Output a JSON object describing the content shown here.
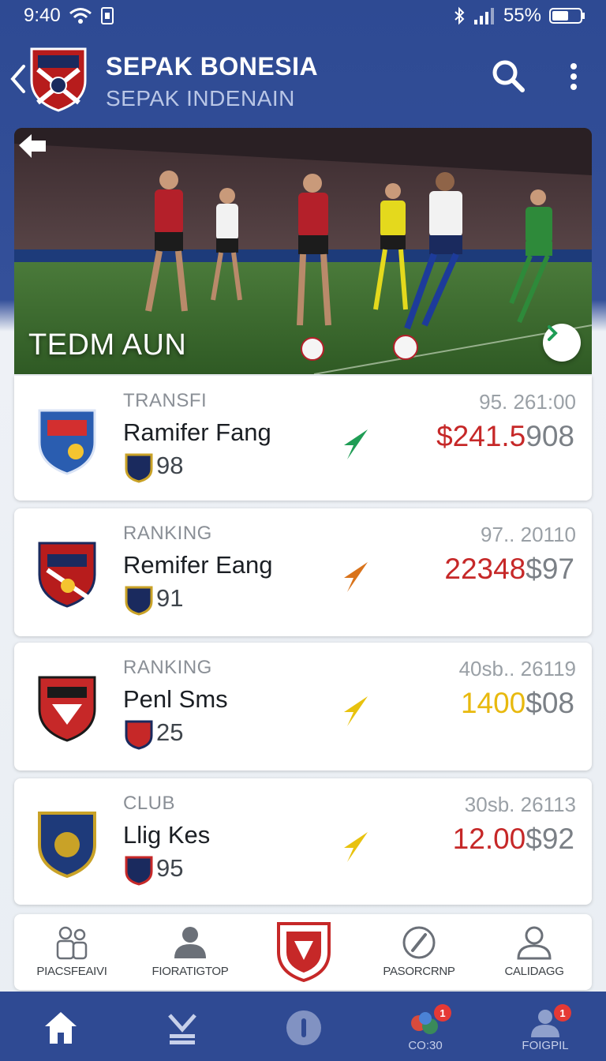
{
  "status_bar": {
    "time": "9:40",
    "battery": "55%"
  },
  "header": {
    "title": "SEPAK BONESIA",
    "subtitle": "SEPAK INDENAIN"
  },
  "hero": {
    "caption": "TEDM AUN"
  },
  "cards": [
    {
      "category": "TRANSFI",
      "date": "95. 261:00",
      "name": "Ramifer Fang",
      "score": "98",
      "price_main": "$241.5",
      "price_sub": "908",
      "price_color": "#c62828",
      "trend_color": "#1f9d55"
    },
    {
      "category": "RANKING",
      "date": "97.. 20110",
      "name": "Remifer Eang",
      "score": "91",
      "price_main": "22348",
      "price_sub": "$97",
      "price_color": "#c62828",
      "trend_color": "#d9731b"
    },
    {
      "category": "RANKING",
      "date": "40sb.. 26119",
      "name": "Penl Sms",
      "score": "25",
      "price_main": "1400",
      "price_sub": "$08",
      "price_color": "#e8b90e",
      "trend_color": "#e8c20e"
    },
    {
      "category": "CLUB",
      "date": "30sb. 26113",
      "name": "Llig Kes",
      "score": "95",
      "price_main": "12.00",
      "price_sub": "$92",
      "price_color": "#c62828",
      "trend_color": "#e8c20e"
    }
  ],
  "quick_bar": [
    {
      "label": "PIACSFEAIVI",
      "icon": "people-icon"
    },
    {
      "label": "FIORATIGTOP",
      "icon": "person-icon"
    },
    {
      "label": "",
      "icon": "club-crest-icon"
    },
    {
      "label": "PASORCRNP",
      "icon": "compass-icon"
    },
    {
      "label": "CALIDAGG",
      "icon": "profile-outline-icon"
    }
  ],
  "bottom_nav": [
    {
      "label": "",
      "icon": "home-icon"
    },
    {
      "label": "",
      "icon": "download-icon"
    },
    {
      "label": "",
      "icon": "circle-icon"
    },
    {
      "label": "CO:30",
      "icon": "balls-icon",
      "badge": "1"
    },
    {
      "label": "FOIGPIL",
      "icon": "user-icon",
      "badge": "1"
    }
  ]
}
